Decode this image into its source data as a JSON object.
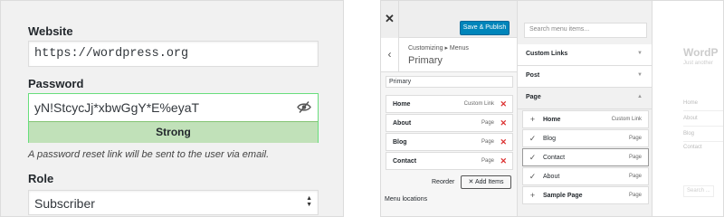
{
  "profile": {
    "website_label": "Website",
    "website_value": "https://wordpress.org",
    "password_label": "Password",
    "password_value": "yN!StcycJj*xbwGgY*E%eyaT",
    "strength": "Strong",
    "reset_note": "A password reset link will be sent to the user via email.",
    "role_label": "Role",
    "role_value": "Subscriber"
  },
  "customizer": {
    "close": "✕",
    "save_button": "Save & Publish",
    "back": "‹",
    "breadcrumb": "Customizing ▸ Menus",
    "panel_title": "Primary",
    "menu_name": "Primary",
    "menu_items": [
      {
        "title": "Home",
        "type": "Custom Link"
      },
      {
        "title": "About",
        "type": "Page"
      },
      {
        "title": "Blog",
        "type": "Page"
      },
      {
        "title": "Contact",
        "type": "Page"
      }
    ],
    "remove_icon": "✕",
    "reorder": "Reorder",
    "add_items": "✕ Add Items",
    "menu_locations": "Menu locations"
  },
  "available": {
    "search_placeholder": "Search menu items...",
    "sections": [
      {
        "label": "Custom Links",
        "arrow": "▼"
      },
      {
        "label": "Post",
        "arrow": "▼"
      },
      {
        "label": "Page",
        "arrow": "▲"
      }
    ],
    "items": [
      {
        "icon": "+",
        "title": "Home",
        "type": "Custom Link"
      },
      {
        "icon": "✓",
        "title": "Blog",
        "type": "Page"
      },
      {
        "icon": "✓",
        "title": "Contact",
        "type": "Page"
      },
      {
        "icon": "✓",
        "title": "About",
        "type": "Page"
      },
      {
        "icon": "+",
        "title": "Sample Page",
        "type": "Page"
      }
    ]
  },
  "preview": {
    "site_title": "WordP",
    "tagline": "Just another",
    "nav": [
      "Home",
      "About",
      "Blog",
      "Contact"
    ],
    "search": "Search ..."
  }
}
